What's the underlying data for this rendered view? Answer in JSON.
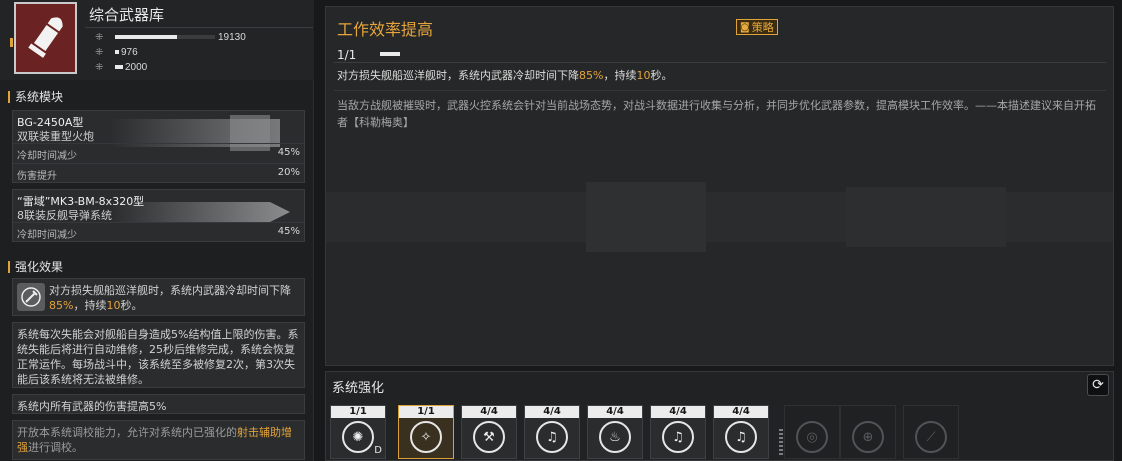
{
  "weapon": {
    "name": "综合武器库",
    "stats": [
      {
        "icon": "damage-stat-icon",
        "glyph": "⁜",
        "value": "19130",
        "fill": 0.62
      },
      {
        "icon": "range-stat-icon",
        "glyph": "⁜",
        "value": "976",
        "fill": 0.03
      },
      {
        "icon": "speed-stat-icon",
        "glyph": "⁜",
        "value": "2000",
        "fill": 0.07
      }
    ]
  },
  "modules_section": {
    "title": "系统模块",
    "modules": [
      {
        "name": "BG-2450A型",
        "desc": "双联装重型火炮",
        "rows": [
          {
            "label": "冷却时间减少",
            "value": "45%"
          },
          {
            "label": "伤害提升",
            "value": "20%"
          }
        ]
      },
      {
        "name": "“雷域”MK3-BM-8x320型",
        "desc": "8联装反舰导弹系统",
        "rows": [
          {
            "label": "冷却时间减少",
            "value": "45%"
          }
        ]
      }
    ]
  },
  "effects_section": {
    "title": "强化效果",
    "effect1_pre": "对方损失舰船巡洋舰时，系统内武器冷却时间下降",
    "effect1_hl": "85%",
    "effect1_mid": "，持续",
    "effect1_hl2": "10",
    "effect1_post": "秒。",
    "effect2": "系统每次失能会对舰船自身造成5%结构值上限的伤害。系统失能后将进行自动维修，25秒后维修完成，系统会恢复正常运作。每场战斗中，该系统至多被修复2次，第3次失能后该系统将无法被维修。",
    "effect3": "系统内所有武器的伤害提高5%",
    "effect4_pre": "开放本系统调校能力，允许对系统内已强化的",
    "effect4_hl": "射击辅助增强",
    "effect4_post": "进行调校。"
  },
  "detail": {
    "title": "工作效率提高",
    "strategy_label": "策略",
    "level": "1/1",
    "effect_pre": "对方损失舰船巡洋舰时，系统内武器冷却时间下降",
    "effect_hl": "85%",
    "effect_mid": "，持续",
    "effect_hl2": "10",
    "effect_post": "秒。",
    "lore": "当敌方战舰被摧毁时，武器火控系统会针对当前战场态势，对战斗数据进行收集与分析，并同步优化武器参数，提高模块工作效率。——本描述建议来自开拓者【科勒梅奥】"
  },
  "upgrade": {
    "title": "系统强化",
    "slots": [
      {
        "count": "1/1",
        "icon": "burst-icon",
        "glyph": "✺",
        "sub": "D",
        "state": "normal"
      },
      {
        "count": "1/1",
        "icon": "guitar-boost-icon",
        "glyph": "✧",
        "sub": "",
        "state": "selected"
      },
      {
        "count": "4/4",
        "icon": "hammer-icon",
        "glyph": "⚒",
        "sub": "",
        "state": "normal"
      },
      {
        "count": "4/4",
        "icon": "guitar-icon",
        "glyph": "♫",
        "sub": "",
        "state": "normal"
      },
      {
        "count": "4/4",
        "icon": "heat-icon",
        "glyph": "♨",
        "sub": "",
        "state": "normal"
      },
      {
        "count": "4/4",
        "icon": "guitar-icon",
        "glyph": "♫",
        "sub": "",
        "state": "normal"
      },
      {
        "count": "4/4",
        "icon": "guitar-icon",
        "glyph": "♫",
        "sub": "",
        "state": "normal"
      },
      {
        "count": "",
        "icon": "locked-radar-icon",
        "glyph": "◎",
        "sub": "",
        "state": "locked"
      },
      {
        "count": "",
        "icon": "locked-target-icon",
        "glyph": "⊕",
        "sub": "",
        "state": "locked"
      },
      {
        "count": "",
        "icon": "locked-missile-icon",
        "glyph": "⟋",
        "sub": "",
        "state": "locked"
      }
    ]
  },
  "colors": {
    "accent": "#e0a43a",
    "weapon_bg": "#6b2222"
  }
}
